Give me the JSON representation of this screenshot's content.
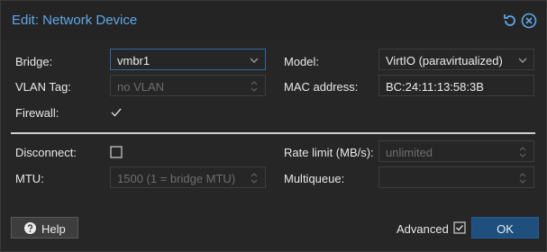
{
  "dialog": {
    "title": "Edit: Network Device",
    "icons": [
      "reset-icon",
      "close-icon"
    ]
  },
  "form": {
    "bridge": {
      "label": "Bridge:",
      "value": "vmbr1"
    },
    "vlan_tag": {
      "label": "VLAN Tag:",
      "placeholder": "no VLAN"
    },
    "firewall": {
      "label": "Firewall:",
      "checked": true
    },
    "model": {
      "label": "Model:",
      "value": "VirtIO (paravirtualized)"
    },
    "mac_address": {
      "label": "MAC address:",
      "value": "BC:24:11:13:58:3B"
    },
    "disconnect": {
      "label": "Disconnect:",
      "checked": false
    },
    "mtu": {
      "label": "MTU:",
      "placeholder": "1500 (1 = bridge MTU)"
    },
    "rate_limit": {
      "label": "Rate limit (MB/s):",
      "placeholder": "unlimited"
    },
    "multiqueue": {
      "label": "Multiqueue:",
      "value": ""
    }
  },
  "footer": {
    "help_label": "Help",
    "advanced_label": "Advanced",
    "advanced_checked": true,
    "ok_label": "OK"
  },
  "colors": {
    "accent": "#5fa7e8",
    "ok_button": "#1f4f7d",
    "background": "#262626"
  }
}
